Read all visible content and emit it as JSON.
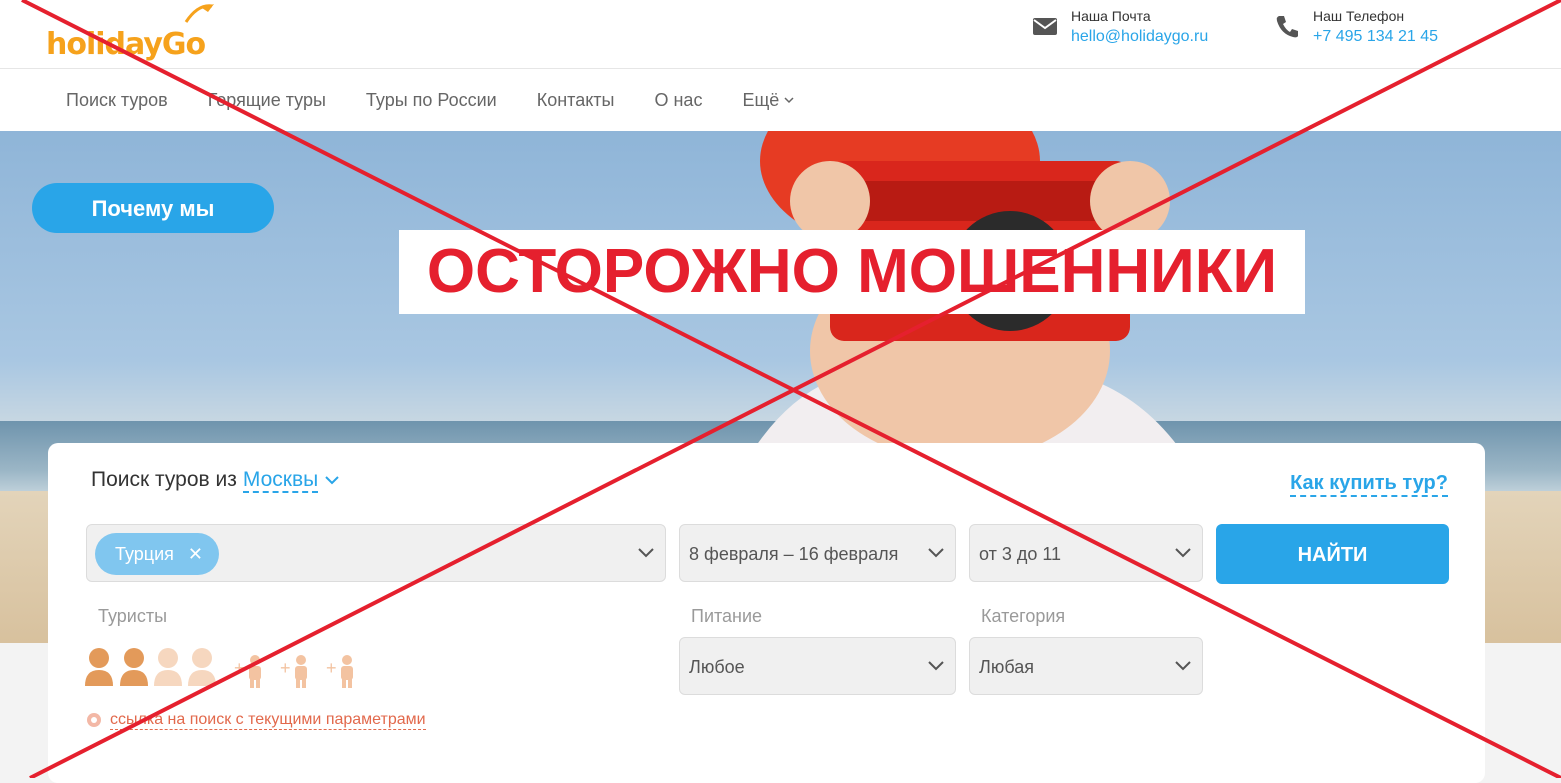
{
  "header": {
    "logo_text": "holidayGo",
    "mail": {
      "label": "Наша Почта",
      "value": "hello@holidaygo.ru"
    },
    "phone": {
      "label": "Наш Телефон",
      "value": "+7 495 134 21 45"
    }
  },
  "nav": {
    "items": [
      "Поиск туров",
      "Горящие туры",
      "Туры по России",
      "Контакты",
      "О нас",
      "Ещё"
    ]
  },
  "hero": {
    "why_button": "Почему мы",
    "warning": "ОСТОРОЖНО МОШЕННИКИ"
  },
  "search": {
    "title_prefix": "Поиск туров из",
    "city": "Москвы",
    "how_to_buy": "Как купить тур?",
    "country_chip": "Турция",
    "chip_close": "✕",
    "dates": "8 февраля – 16 февраля",
    "nights": "от 3 до 11",
    "find_button": "НАЙТИ",
    "tourists_label": "Туристы",
    "food_label": "Питание",
    "food_value": "Любое",
    "category_label": "Категория",
    "category_value": "Любая",
    "tourists": {
      "adults_selected": 2,
      "adults_max": 4,
      "children_slots": 3
    },
    "link_text": "ссылка на поиск с текущими параметрами"
  },
  "colors": {
    "accent": "#29a5e8",
    "logo": "#f6a21c",
    "warning": "#e5202e",
    "link": "#e2694c"
  }
}
